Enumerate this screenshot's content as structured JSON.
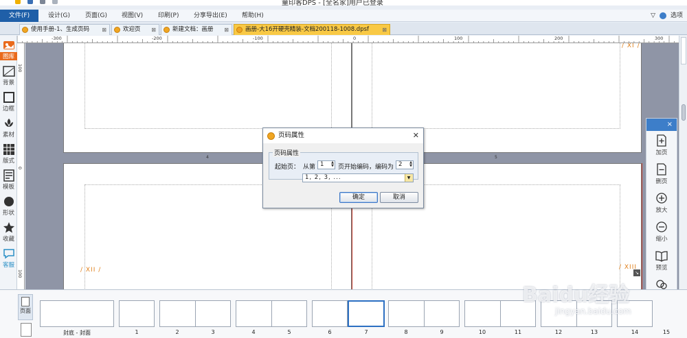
{
  "window": {
    "title": "童印客DPS - [全名家]用户已登录"
  },
  "menu": {
    "file": "文件(F)",
    "items": [
      "设计(G)",
      "页面(G)",
      "视图(V)",
      "印刷(P)",
      "分享导出(E)",
      "帮助(H)"
    ],
    "options": "选项"
  },
  "tabs": [
    {
      "label": "使用手册-1、生成页码"
    },
    {
      "label": "欢迎页"
    },
    {
      "label": "新建文档：画册"
    },
    {
      "label": "画册-大16开硬壳精装-文档200118-1008.dpsf",
      "active": true
    }
  ],
  "sidebar": {
    "items": [
      {
        "label": "图库",
        "icon": "gallery-icon",
        "active": true
      },
      {
        "label": "背景",
        "icon": "background-icon"
      },
      {
        "label": "边框",
        "icon": "border-icon"
      },
      {
        "label": "素材",
        "icon": "material-icon"
      },
      {
        "label": "版式",
        "icon": "layout-icon"
      },
      {
        "label": "模板",
        "icon": "template-icon"
      },
      {
        "label": "形状",
        "icon": "shape-icon"
      },
      {
        "label": "收藏",
        "icon": "star-icon"
      },
      {
        "label": "客服",
        "icon": "chat-icon"
      }
    ]
  },
  "ruler": {
    "h_labels": [
      "-300",
      "-200",
      "-100",
      "0",
      "100",
      "200",
      "300"
    ],
    "v_labels": [
      "100",
      "0",
      "100"
    ]
  },
  "canvas": {
    "page_numbers": [
      "/ XI /",
      "/ XII /",
      "/ XIII"
    ],
    "spread_markers": [
      "4",
      "5"
    ]
  },
  "right_panel": {
    "close": "×",
    "items": [
      {
        "label": "加页",
        "icon": "add-page-icon"
      },
      {
        "label": "删页",
        "icon": "delete-page-icon"
      },
      {
        "label": "放大",
        "icon": "zoom-in-icon"
      },
      {
        "label": "缩小",
        "icon": "zoom-out-icon"
      },
      {
        "label": "预览",
        "icon": "preview-icon"
      },
      {
        "label": "分享",
        "icon": "share-icon"
      }
    ]
  },
  "dialog": {
    "title": "页码属性",
    "group_label": "页码属性",
    "start_label": "起始页：",
    "from_label": "从第",
    "from_value": "1",
    "middle_label": "页开始编码，编码为",
    "code_value": "2",
    "format_value": "1, 2, 3, ...",
    "ok": "确定",
    "cancel": "取消"
  },
  "bottom": {
    "page_tab_label": "页面",
    "thumb_labels": [
      "封底 - 封面",
      "1",
      "2",
      "3",
      "4",
      "5",
      "6",
      "7",
      "8",
      "9",
      "10",
      "11",
      "12",
      "13",
      "14",
      "15"
    ],
    "selected": "7"
  },
  "watermark": {
    "main": "Baidu经验",
    "sub": "jingyan.baidu.com"
  },
  "colors": {
    "accent": "#1f5fa8",
    "tab_active": "#f9c945",
    "page_number": "#e0801c",
    "sidebar_active": "#e96a1c"
  }
}
